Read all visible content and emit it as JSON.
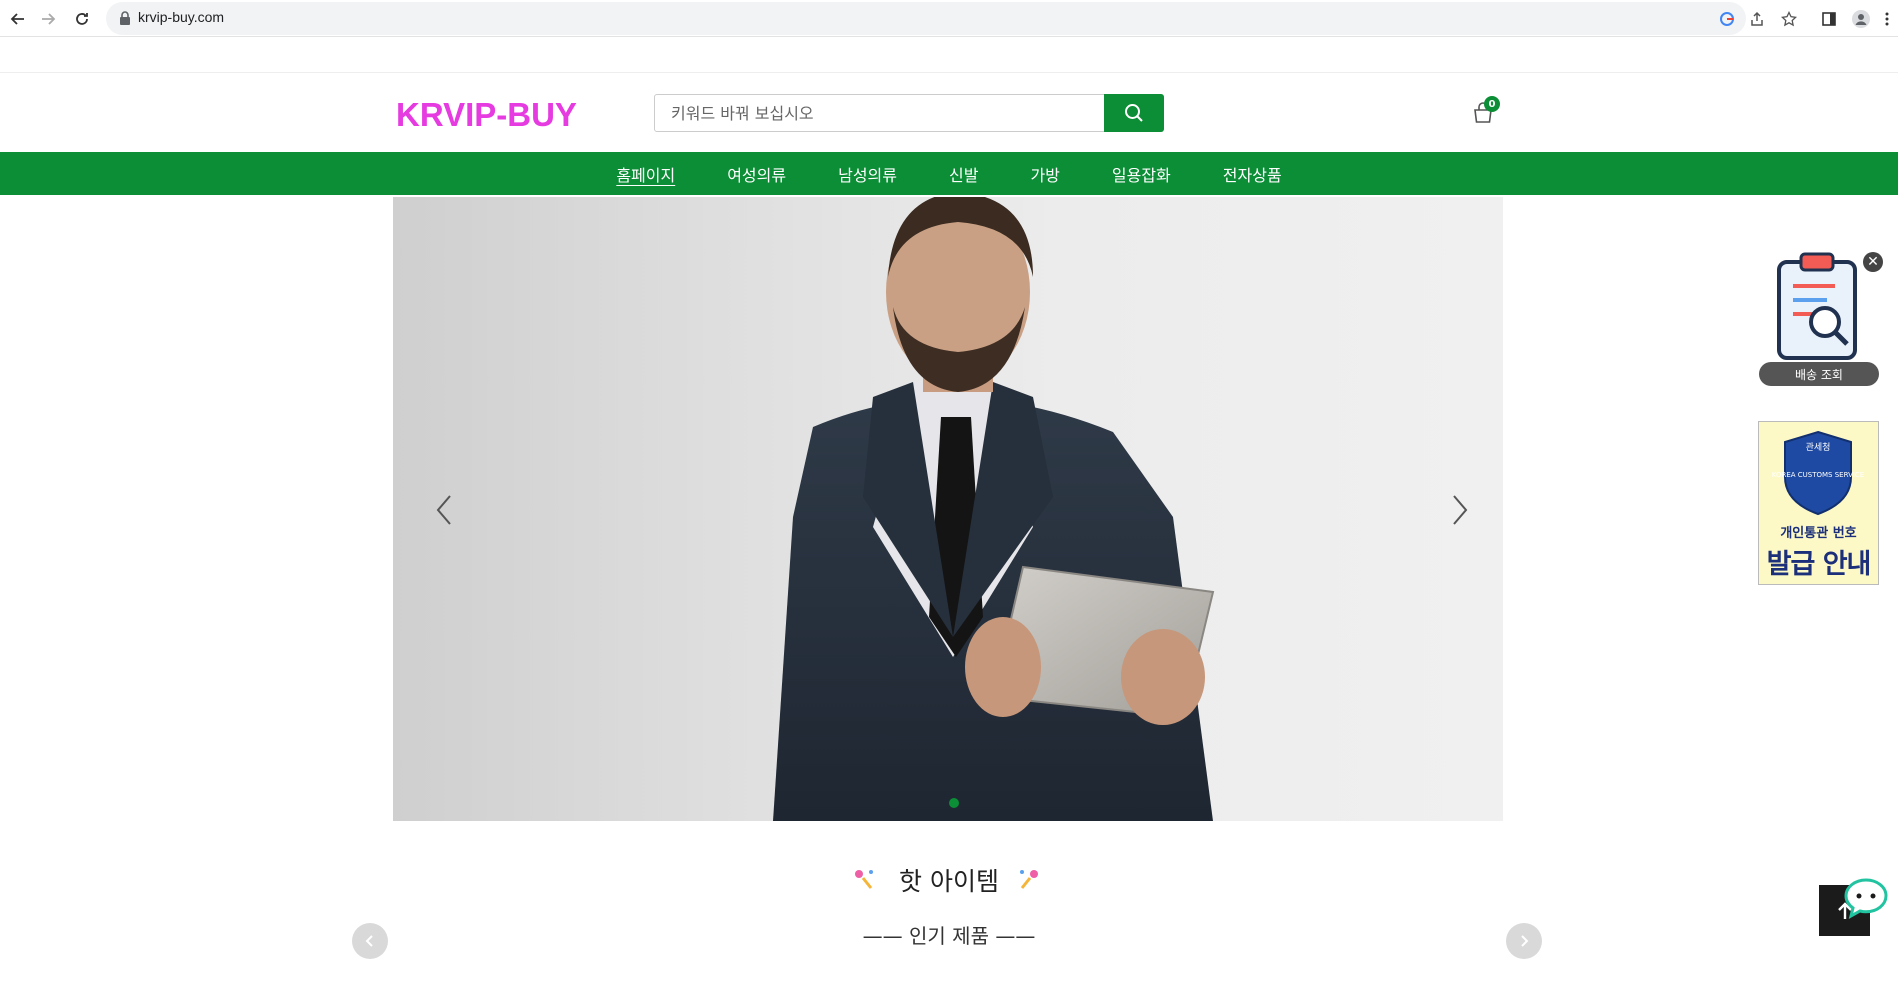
{
  "browser": {
    "url": "krvip-buy.com"
  },
  "header": {
    "logo": "KRVIP-BUY",
    "search_placeholder": "키워드 바꿔 보십시오",
    "cart_count": "0"
  },
  "nav": {
    "items": [
      {
        "label": "홈페이지",
        "active": true
      },
      {
        "label": "여성의류"
      },
      {
        "label": "남성의류"
      },
      {
        "label": "신발"
      },
      {
        "label": "가방"
      },
      {
        "label": "일용잡화"
      },
      {
        "label": "전자상품"
      }
    ]
  },
  "hot": {
    "title": "핫 아이템",
    "subtitle": "—— 인기 제품 ——"
  },
  "side": {
    "tracking_label": "배송 조회",
    "customs_line1": "개인통관 번호",
    "customs_line2": "발급 안내",
    "badge_top": "관세청",
    "badge_mid": "KOREA CUSTOMS SERVICE"
  },
  "colors": {
    "brand_green": "#0b8e36",
    "logo_pink": "#e53be0"
  }
}
